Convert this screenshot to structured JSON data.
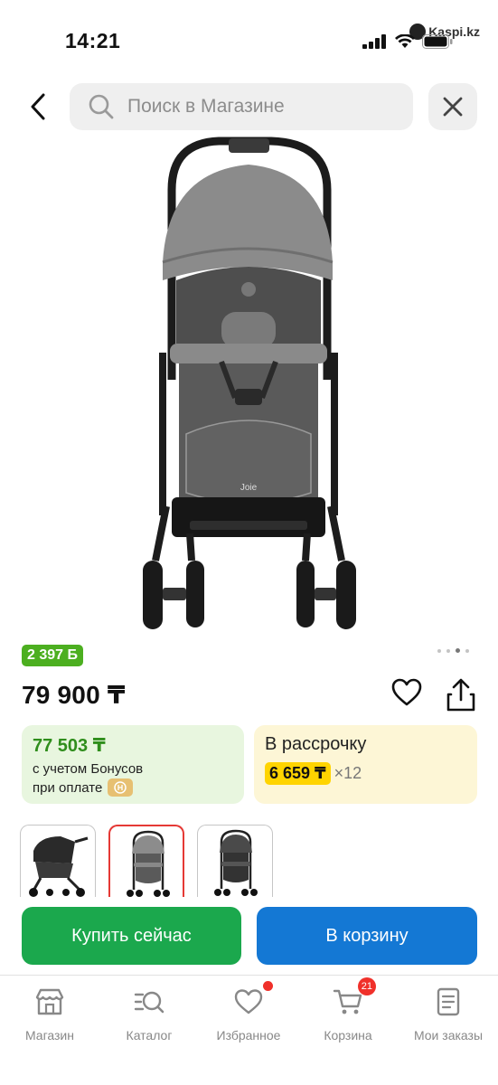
{
  "status_bar": {
    "time": "14:21",
    "watermark": "Kaspi.kz"
  },
  "search": {
    "placeholder": "Поиск в Магазине"
  },
  "product": {
    "image_icon": "baby-stroller-image",
    "bonus_badge": "2 397 Б",
    "price": "79 900 ₸",
    "gallery_dots": 4,
    "gallery_active_index": 2
  },
  "offers": {
    "bonus": {
      "amount": "77 503 ₸",
      "line1": "с учетом Бонусов",
      "line2": "при оплате"
    },
    "installment": {
      "label": "В рассрочку",
      "amount": "6 659 ₸",
      "multiplier": "×12"
    }
  },
  "variants": {
    "count": 3,
    "selected_index": 1
  },
  "actions": {
    "buy_now": "Купить сейчас",
    "add_to_cart": "В корзину"
  },
  "tab_bar": {
    "items": [
      {
        "label": "Магазин",
        "icon": "store-icon"
      },
      {
        "label": "Каталог",
        "icon": "catalog-search-icon"
      },
      {
        "label": "Избранное",
        "icon": "heart-icon"
      },
      {
        "label": "Корзина",
        "icon": "cart-icon",
        "badge": "21"
      },
      {
        "label": "Мои заказы",
        "icon": "orders-icon"
      }
    ]
  },
  "colors": {
    "green_button": "#1ba84d",
    "blue_button": "#1478d4",
    "bonus_green": "#4caf20",
    "installment_yellow": "#ffd400",
    "badge_red": "#f0302a"
  }
}
